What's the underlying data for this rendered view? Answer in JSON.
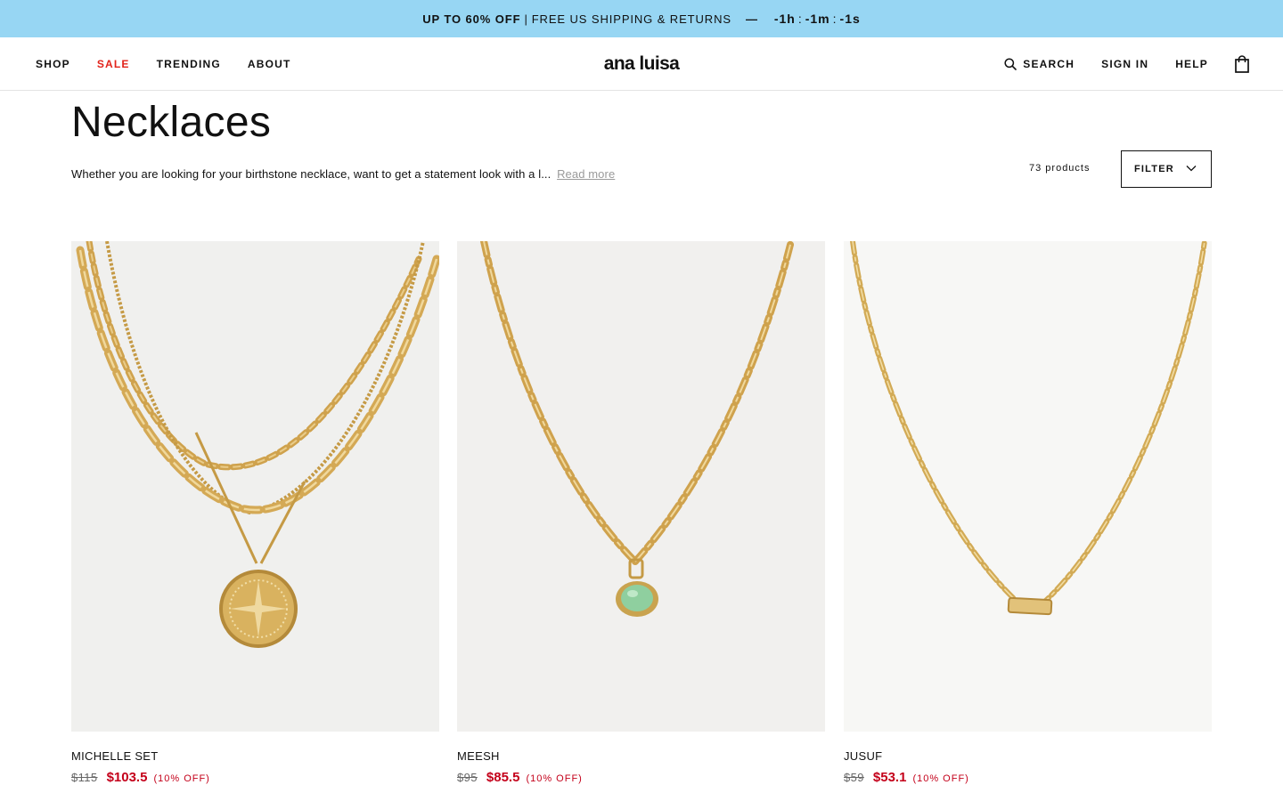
{
  "promo": {
    "offer": "UP TO 60% OFF",
    "divider": "|",
    "shipping": "FREE US SHIPPING & RETURNS",
    "dash": "—",
    "timer": {
      "hours": "-1h",
      "minutes": "-1m",
      "seconds": "-1s"
    },
    "background": "#97d6f3"
  },
  "header": {
    "nav": {
      "shop": "SHOP",
      "sale": "SALE",
      "trending": "TRENDING",
      "about": "ABOUT"
    },
    "logo": "ana luisa",
    "right": {
      "search": "SEARCH",
      "sign_in": "SIGN IN",
      "help": "HELP"
    },
    "icons": {
      "search": "search-icon",
      "bag": "shopping-bag-icon"
    },
    "sale_color": "#e2231a"
  },
  "page": {
    "title": "Necklaces",
    "description": "Whether you are looking for your birthstone necklace, want to get a statement look with a l...",
    "read_more": "Read more",
    "product_count": "73 products",
    "filter_label": "FILTER"
  },
  "products": [
    {
      "name": "MICHELLE SET",
      "old_price": "$115",
      "new_price": "$103.5",
      "discount": "(10% OFF)"
    },
    {
      "name": "MEESH",
      "old_price": "$95",
      "new_price": "$85.5",
      "discount": "(10% OFF)"
    },
    {
      "name": "JUSUF",
      "old_price": "$59",
      "new_price": "$53.1",
      "discount": "(10% OFF)"
    }
  ],
  "colors": {
    "price": "#c4001a",
    "gold": "#d9b25f",
    "pendant_green": "#8fcf9f"
  }
}
